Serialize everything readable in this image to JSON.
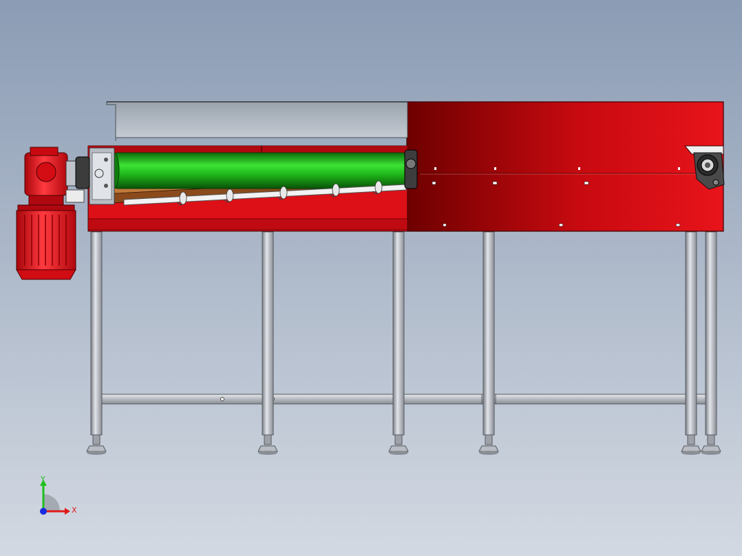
{
  "scene": {
    "description_visible": "",
    "background": {
      "top": "#8c9db5",
      "bottom": "#cfd6df"
    },
    "colors": {
      "frame_red": "#e0111a",
      "frame_red_dark": "#7a0000",
      "roller_green": "#1fb81a",
      "steel": "#c9cdd3",
      "steel_dark": "#6d7178",
      "brown_liner": "#8a4a1c",
      "motor_red": "#e8141b"
    },
    "icons": {
      "gear_motor": "gear-motor-icon",
      "bearing": "bearing-icon",
      "leveling_foot": "leveling-foot-icon",
      "triad": "coordinate-triad-icon"
    }
  },
  "triad": {
    "x_label": "X",
    "y_label": "Y",
    "x_color": "#e01a1a",
    "y_color": "#1fbf1f",
    "z_color": "#1a2ae0"
  }
}
